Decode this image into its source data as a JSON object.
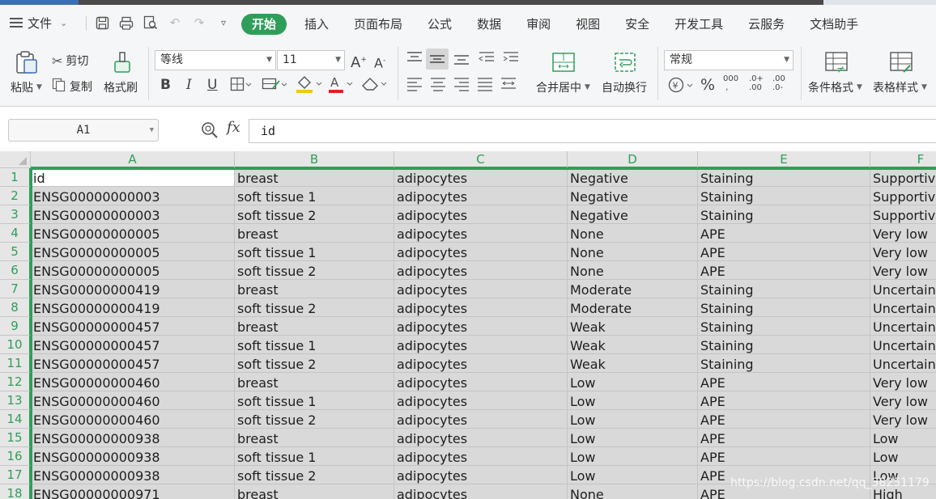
{
  "menubar": {
    "file_label": "文件",
    "items": [
      "开始",
      "插入",
      "页面布局",
      "公式",
      "数据",
      "审阅",
      "视图",
      "安全",
      "开发工具",
      "云服务",
      "文档助手"
    ],
    "active_index": 0
  },
  "ribbon": {
    "paste_label": "粘贴",
    "cut_label": "剪切",
    "copy_label": "复制",
    "format_painter_label": "格式刷",
    "font_name": "等线",
    "font_size": "11",
    "bold_label": "B",
    "italic_label": "I",
    "underline_label": "U",
    "merge_center_label": "合并居中",
    "wrap_text_label": "自动换行",
    "number_format": "常规",
    "conditional_format_label": "条件格式",
    "table_style_label": "表格样式",
    "accent_color": "#2f9e5a"
  },
  "formula_bar": {
    "name_box": "A1",
    "fx_label": "fx",
    "value": "id"
  },
  "sheet": {
    "columns": [
      "A",
      "B",
      "C",
      "D",
      "E",
      "F"
    ],
    "row_numbers": [
      "1",
      "2",
      "3",
      "4",
      "5",
      "6",
      "7",
      "8",
      "9",
      "10",
      "11",
      "12",
      "13",
      "14",
      "15",
      "16",
      "17",
      "18"
    ],
    "rows": [
      [
        "id",
        "breast",
        "adipocytes",
        "Negative",
        "Staining",
        "Supportive"
      ],
      [
        "ENSG00000000003",
        "soft tissue 1",
        "adipocytes",
        "Negative",
        "Staining",
        "Supportive"
      ],
      [
        "ENSG00000000003",
        "soft tissue 2",
        "adipocytes",
        "Negative",
        "Staining",
        "Supportive"
      ],
      [
        "ENSG00000000005",
        "breast",
        "adipocytes",
        "None",
        "APE",
        "Very low"
      ],
      [
        "ENSG00000000005",
        "soft tissue 1",
        "adipocytes",
        "None",
        "APE",
        "Very low"
      ],
      [
        "ENSG00000000005",
        "soft tissue 2",
        "adipocytes",
        "None",
        "APE",
        "Very low"
      ],
      [
        "ENSG00000000419",
        "breast",
        "adipocytes",
        "Moderate",
        "Staining",
        "Uncertain"
      ],
      [
        "ENSG00000000419",
        "soft tissue 2",
        "adipocytes",
        "Moderate",
        "Staining",
        "Uncertain"
      ],
      [
        "ENSG00000000457",
        "breast",
        "adipocytes",
        "Weak",
        "Staining",
        "Uncertain"
      ],
      [
        "ENSG00000000457",
        "soft tissue 1",
        "adipocytes",
        "Weak",
        "Staining",
        "Uncertain"
      ],
      [
        "ENSG00000000457",
        "soft tissue 2",
        "adipocytes",
        "Weak",
        "Staining",
        "Uncertain"
      ],
      [
        "ENSG00000000460",
        "breast",
        "adipocytes",
        "Low",
        "APE",
        "Very low"
      ],
      [
        "ENSG00000000460",
        "soft tissue 1",
        "adipocytes",
        "Low",
        "APE",
        "Very low"
      ],
      [
        "ENSG00000000460",
        "soft tissue 2",
        "adipocytes",
        "Low",
        "APE",
        "Very low"
      ],
      [
        "ENSG00000000938",
        "breast",
        "adipocytes",
        "Low",
        "APE",
        "Low"
      ],
      [
        "ENSG00000000938",
        "soft tissue 1",
        "adipocytes",
        "Low",
        "APE",
        "Low"
      ],
      [
        "ENSG00000000938",
        "soft tissue 2",
        "adipocytes",
        "Low",
        "APE",
        "Low"
      ],
      [
        "ENSG00000000971",
        "breast",
        "adipocytes",
        "None",
        "APE",
        "High"
      ]
    ]
  },
  "watermark": "https://blog.csdn.net/qq_38251179"
}
